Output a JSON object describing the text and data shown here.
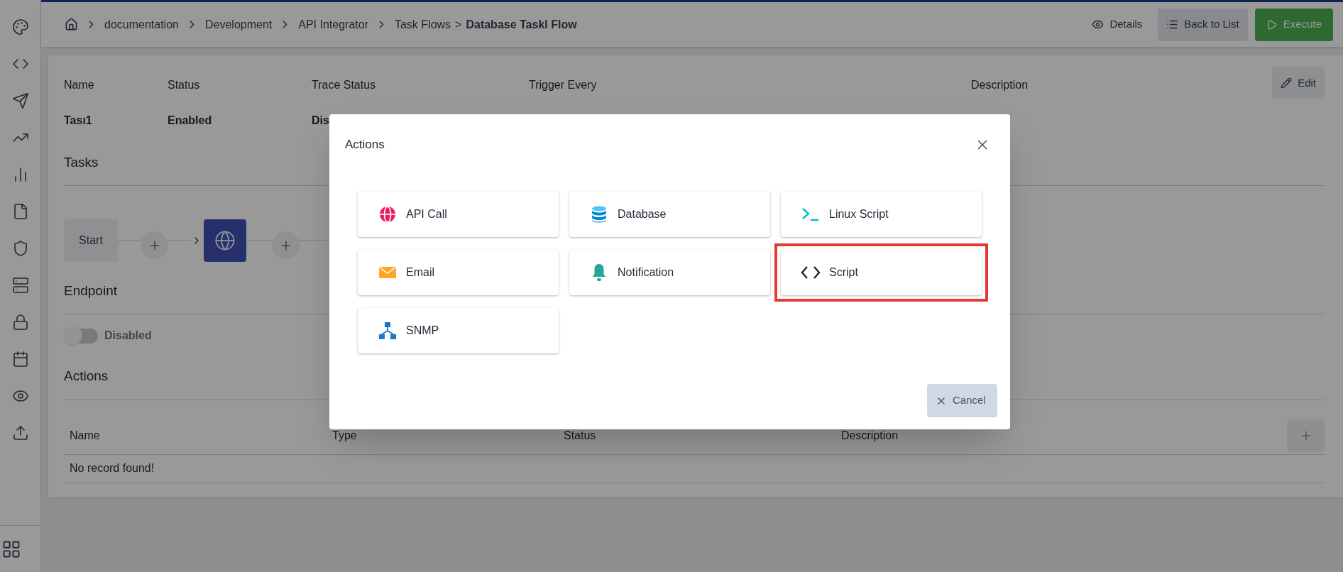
{
  "breadcrumb": {
    "links": [
      "documentation",
      "Development",
      "API Integrator"
    ],
    "parent": "Task Flows",
    "separator": ">",
    "current": "Database Taskl Flow"
  },
  "header_buttons": [
    {
      "label": "Details",
      "kind": "plain"
    },
    {
      "label": "Back to List",
      "kind": "secondary"
    },
    {
      "label": "Execute",
      "kind": "primary"
    }
  ],
  "details": {
    "fields": [
      {
        "label": "Name",
        "value": "Tası1"
      },
      {
        "label": "Status",
        "value": "Enabled"
      },
      {
        "label": "Trace Status",
        "value": "Dis"
      },
      {
        "label": "Trigger Every"
      },
      {
        "label": "Description"
      }
    ],
    "edit_button": "Edit"
  },
  "tasks": {
    "title": "Tasks",
    "start": "Start"
  },
  "endpoint": {
    "title": "Endpoint",
    "toggle": {
      "on": false,
      "label": "Disabled"
    }
  },
  "actions": {
    "title": "Actions",
    "columns": [
      "Name",
      "Type",
      "Status",
      "Description"
    ],
    "empty": "No record found!"
  },
  "modal": {
    "title": "Actions",
    "options": [
      {
        "label": "API Call",
        "kind": "api",
        "highlighted": false
      },
      {
        "label": "Database",
        "kind": "database",
        "highlighted": false
      },
      {
        "label": "Linux Script",
        "kind": "terminal",
        "highlighted": false
      },
      {
        "label": "Email",
        "kind": "email",
        "highlighted": false
      },
      {
        "label": "Notification",
        "kind": "notification",
        "highlighted": false
      },
      {
        "label": "Script",
        "kind": "script",
        "highlighted": true
      },
      {
        "label": "SNMP",
        "kind": "snmp",
        "highlighted": false
      }
    ],
    "cancel": "Cancel"
  }
}
